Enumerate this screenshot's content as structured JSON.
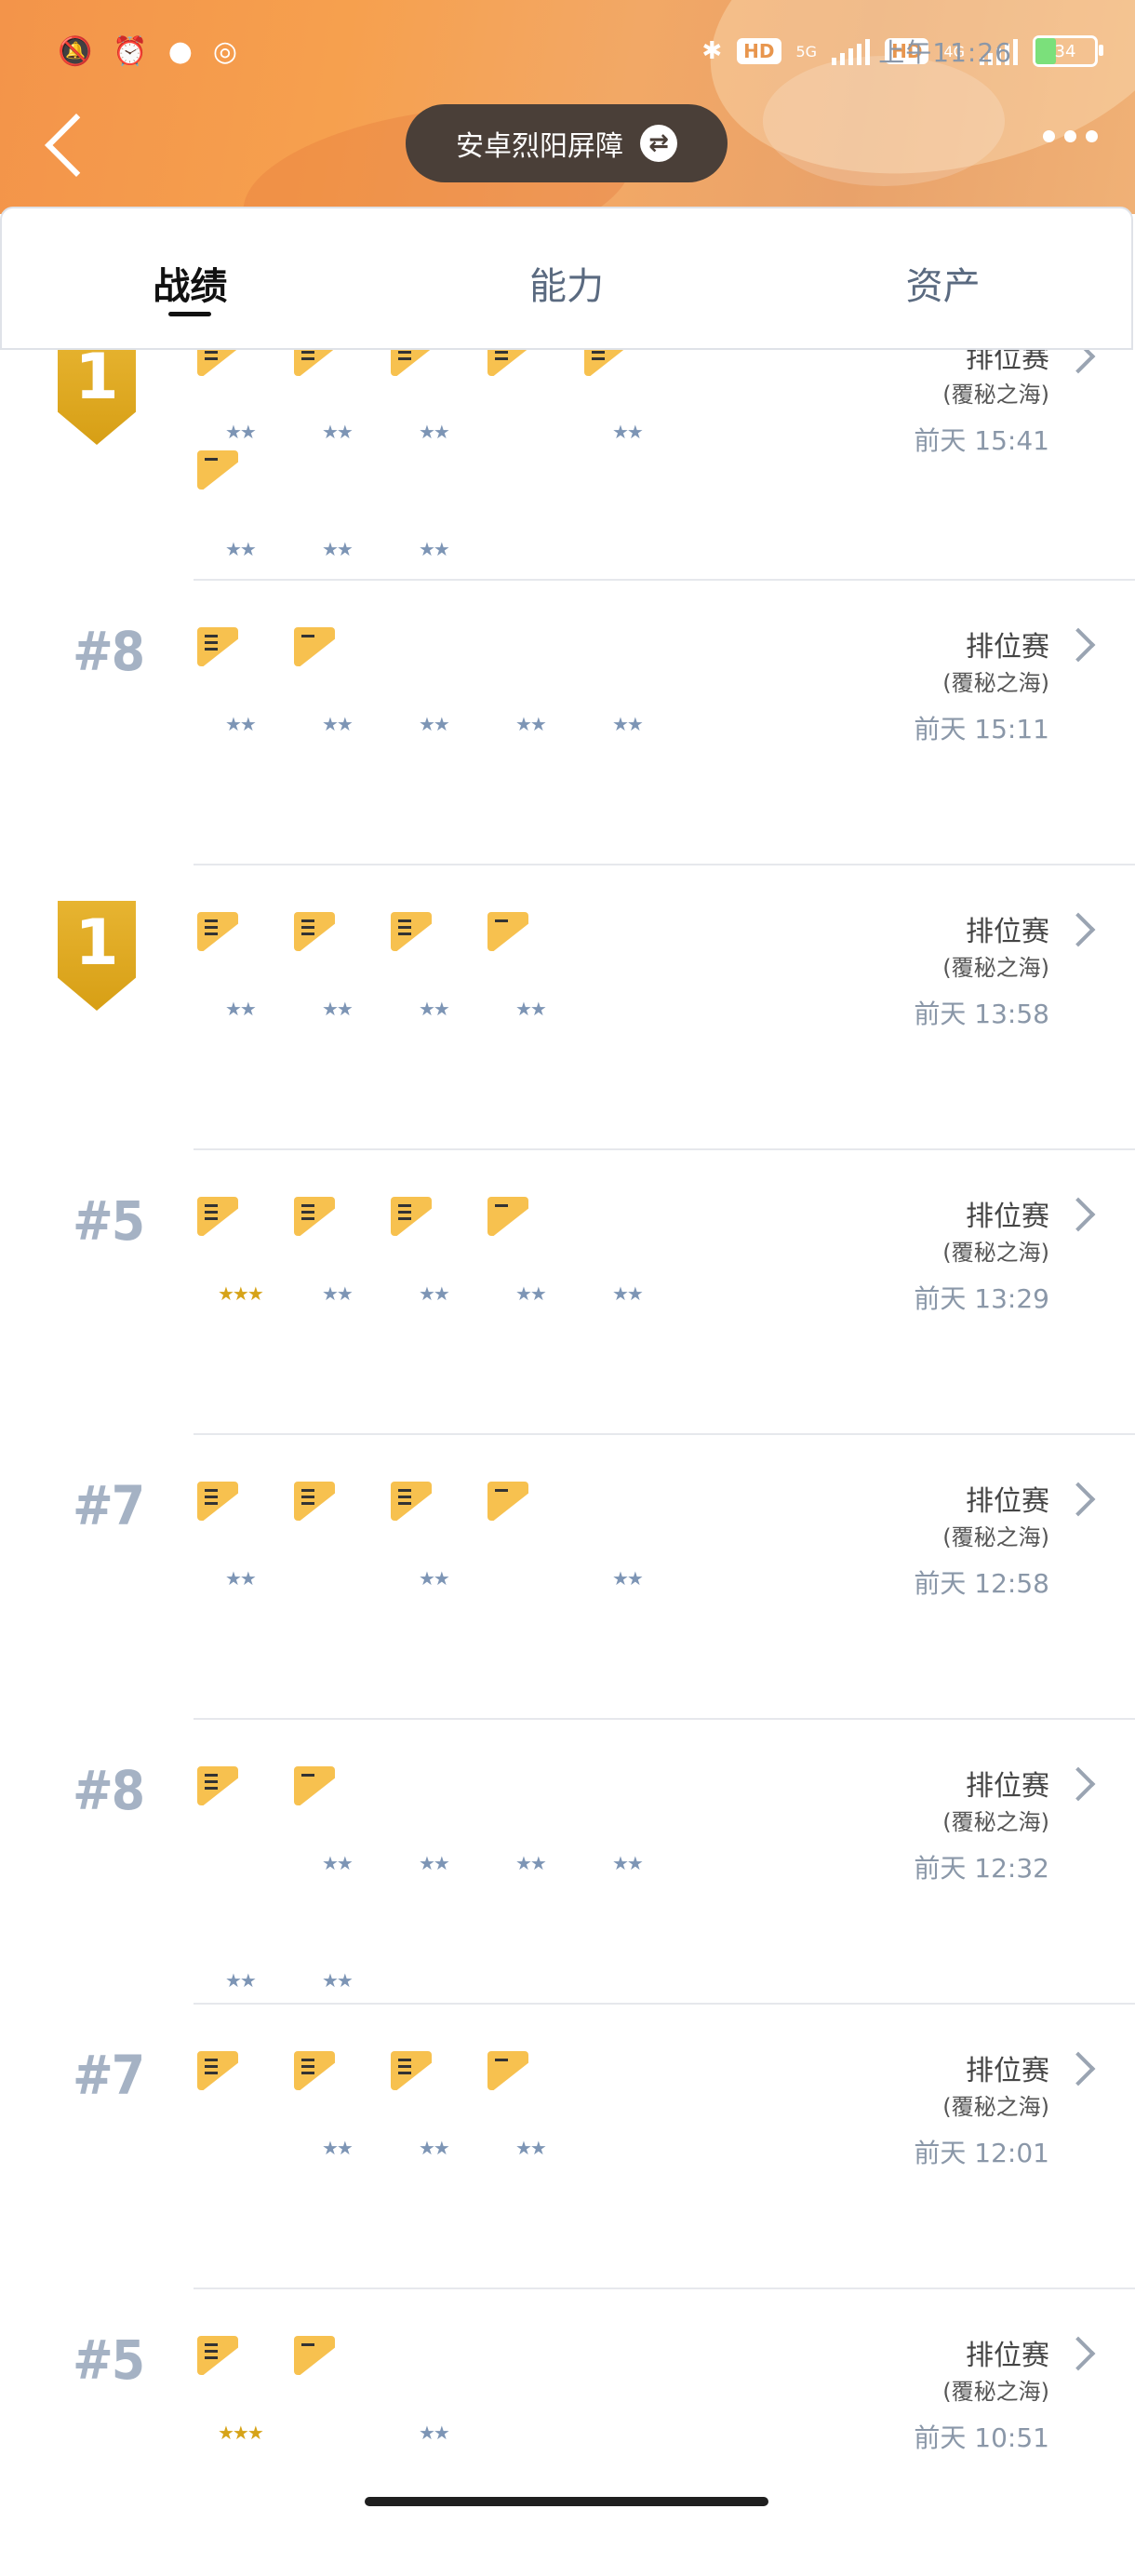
{
  "status_bar": {
    "time": "上午11:26",
    "battery": "34",
    "net1": "5G",
    "net2": "4G",
    "hd": "HD"
  },
  "header": {
    "title": "安卓烈阳屏障",
    "swap_icon": "swap-icon"
  },
  "tabs": [
    {
      "label": "战绩",
      "active": true
    },
    {
      "label": "能力",
      "active": false
    },
    {
      "label": "资产",
      "active": false
    }
  ],
  "matches": [
    {
      "rank": "1",
      "rank_type": "gold",
      "mode": "排位赛",
      "map": "(覆秘之海)",
      "time": "前天 15:41"
    },
    {
      "rank": "#8",
      "rank_type": "text",
      "mode": "排位赛",
      "map": "(覆秘之海)",
      "time": "前天 15:11"
    },
    {
      "rank": "1",
      "rank_type": "gold",
      "mode": "排位赛",
      "map": "(覆秘之海)",
      "time": "前天 13:58"
    },
    {
      "rank": "#5",
      "rank_type": "text",
      "mode": "排位赛",
      "map": "(覆秘之海)",
      "time": "前天 13:29"
    },
    {
      "rank": "#7",
      "rank_type": "text",
      "mode": "排位赛",
      "map": "(覆秘之海)",
      "time": "前天 12:58"
    },
    {
      "rank": "#8",
      "rank_type": "text",
      "mode": "排位赛",
      "map": "(覆秘之海)",
      "time": "前天 12:32"
    },
    {
      "rank": "#7",
      "rank_type": "text",
      "mode": "排位赛",
      "map": "(覆秘之海)",
      "time": "前天 12:01"
    },
    {
      "rank": "#5",
      "rank_type": "text",
      "mode": "排位赛",
      "map": "(覆秘之海)",
      "time": "前天 10:51"
    }
  ],
  "colors": {
    "accent": "#f3944a",
    "badge_gold": "#d9a21a",
    "star_blue": "#7d95b5",
    "star_gold": "#d6a318",
    "rank_gray": "#a5b2c4"
  }
}
